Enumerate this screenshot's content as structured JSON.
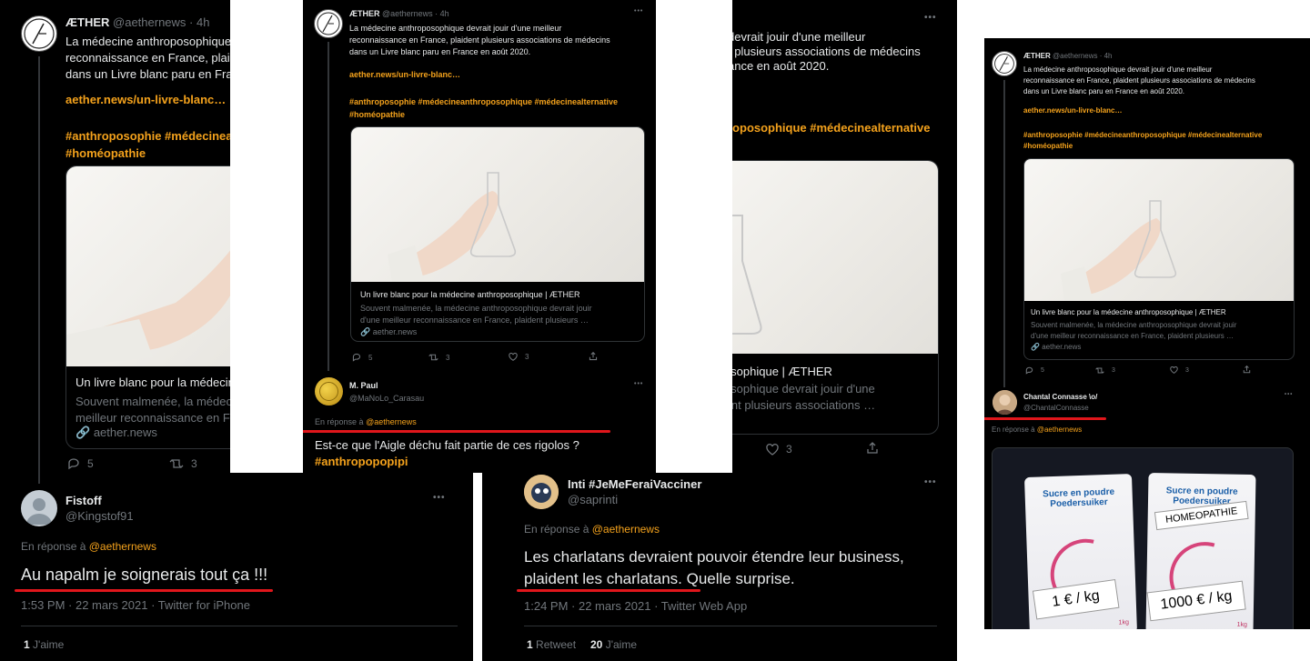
{
  "tweet": {
    "author": "ÆTHER",
    "handle": "@aethernews",
    "handle_time": "@aethernews · 4h",
    "text_lines_a": [
      "La médecine anthroposophique devrait jouir d'une meilleur",
      "reconnaissance en France, plaident plusieurs associations de médecins",
      "dans un Livre blanc paru en France en août 2020."
    ],
    "link": "aether.news/un-livre-blanc…",
    "tags_line1": "#anthroposophie #médecineanthroposophique #médecinealternative",
    "tags_line2": "#homéopathie",
    "card_title": "Un livre blanc pour la médecine anthroposophique | ÆTHER",
    "card_desc_1": "Souvent malmenée, la médecine anthroposophique devrait jouir",
    "card_desc_2": "d'une meilleur reconnaissance en France, plaident plusieurs …",
    "card_domain": "aether.news",
    "replies": "5",
    "retweets": "3",
    "likes": "3"
  },
  "panel1": {
    "text_visible": [
      "La médecine anthroposophique",
      "reconnaissance en France, plaid",
      "dans un Livre blanc paru en Fra"
    ],
    "tags_line1": "#anthroposophie #médecineant",
    "card_title": "Un livre blanc pour la médecin",
    "card_desc_1": "Souvent malmenée, la médecin",
    "card_desc_2": "meilleur reconnaissance en Fr",
    "reply": {
      "author": "Fistoff",
      "handle": "@Kingstof91",
      "replying_to_prefix": "En réponse à",
      "replying_to_handle": "@aethernews",
      "text": "Au napalm je soignerais tout ça !!!",
      "meta": "1:53 PM · 22 mars 2021 · Twitter for iPhone",
      "likes_count": "1",
      "likes_label": "J'aime"
    }
  },
  "panel2": {
    "reply": {
      "author": "M. Paul",
      "handle": "@MaNoLo_Carasau",
      "replying_to_prefix": "En réponse à",
      "replying_to_handle": "@aethernews",
      "text": "Est-ce que l'Aigle déchu fait partie de ces rigolos ?",
      "tag": "#anthropopopipi"
    }
  },
  "panel3": {
    "text_visible": [
      "devrait jouir d'une meilleur",
      "t plusieurs associations de médecins",
      "ance en août 2020."
    ],
    "tags_line1": "roposophique #médecinealternative",
    "card_title": "e anthroposophique | ÆTHER",
    "card_desc_1": "e anthroposophique devrait jouir d'une",
    "card_desc_2": "nce, plaident plusieurs associations …",
    "reply": {
      "author": "Inti #JeMeFeraiVacciner",
      "handle": "@saprinti",
      "replying_to_prefix": "En réponse à",
      "replying_to_handle": "@aethernews",
      "text_line1": "Les charlatans devraient pouvoir étendre leur business,",
      "text_line2": "plaident les charlatans. Quelle surprise.",
      "meta": "1:24 PM · 22 mars 2021 · Twitter Web App",
      "retweets_count": "1",
      "retweets_label": "Retweet",
      "likes_count": "20",
      "likes_label": "J'aime"
    }
  },
  "panel4": {
    "reply": {
      "author": "Chantal Connasse \\o/",
      "handle": "@ChantalConnasse",
      "replying_to_prefix": "En réponse à",
      "replying_to_handle": "@aethernews"
    },
    "bag_left": {
      "brand1": "Sucre en poudre",
      "brand2": "Poedersuiker",
      "sign": "1 € / kg",
      "weight": "1kg"
    },
    "bag_right": {
      "brand1": "Sucre en poudre",
      "brand2": "Poedersuiker",
      "label": "HOMEOPATHIE",
      "sign": "1000 € / kg",
      "weight": "1kg"
    }
  },
  "more_label": "•••",
  "colors": {
    "accent": "#f4a21c",
    "underline": "#e0161b",
    "bg": "#000000",
    "muted": "#71767b"
  }
}
